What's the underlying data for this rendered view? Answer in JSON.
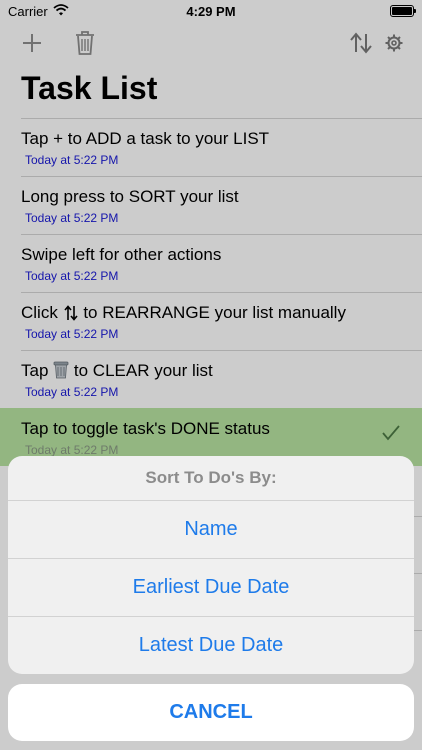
{
  "status": {
    "carrier": "Carrier",
    "time": "4:29 PM"
  },
  "toolbar": {
    "add_icon": "plus-icon",
    "trash_icon": "trash-icon",
    "sort_icon": "rearrange-arrows-icon",
    "settings_icon": "gear-icon"
  },
  "page": {
    "title": "Task List"
  },
  "tasks": [
    {
      "title": "Tap + to ADD a task to your LIST",
      "date": "Today at 5:22 PM"
    },
    {
      "title": "Long press to SORT your list",
      "date": "Today at 5:22 PM"
    },
    {
      "title": "Swipe left for other actions",
      "date": "Today at 5:22 PM"
    },
    {
      "title_before": "Click",
      "title_after": "to REARRANGE your list manually",
      "date": "Today at 5:22 PM"
    },
    {
      "title_before": "Tap",
      "title_after": "to CLEAR your list",
      "date": "Today at 5:22 PM"
    },
    {
      "title": "Tap to toggle task's DONE status",
      "date": "Today at 5:22 PM",
      "done": true
    }
  ],
  "sort_sheet": {
    "title": "Sort To Do's By:",
    "options": [
      "Name",
      "Earliest Due Date",
      "Latest Due Date"
    ],
    "cancel": "CANCEL"
  },
  "colors": {
    "accent": "#1e7bea",
    "date_text": "#1b1bd6",
    "done_row": "#b8e4a2"
  }
}
